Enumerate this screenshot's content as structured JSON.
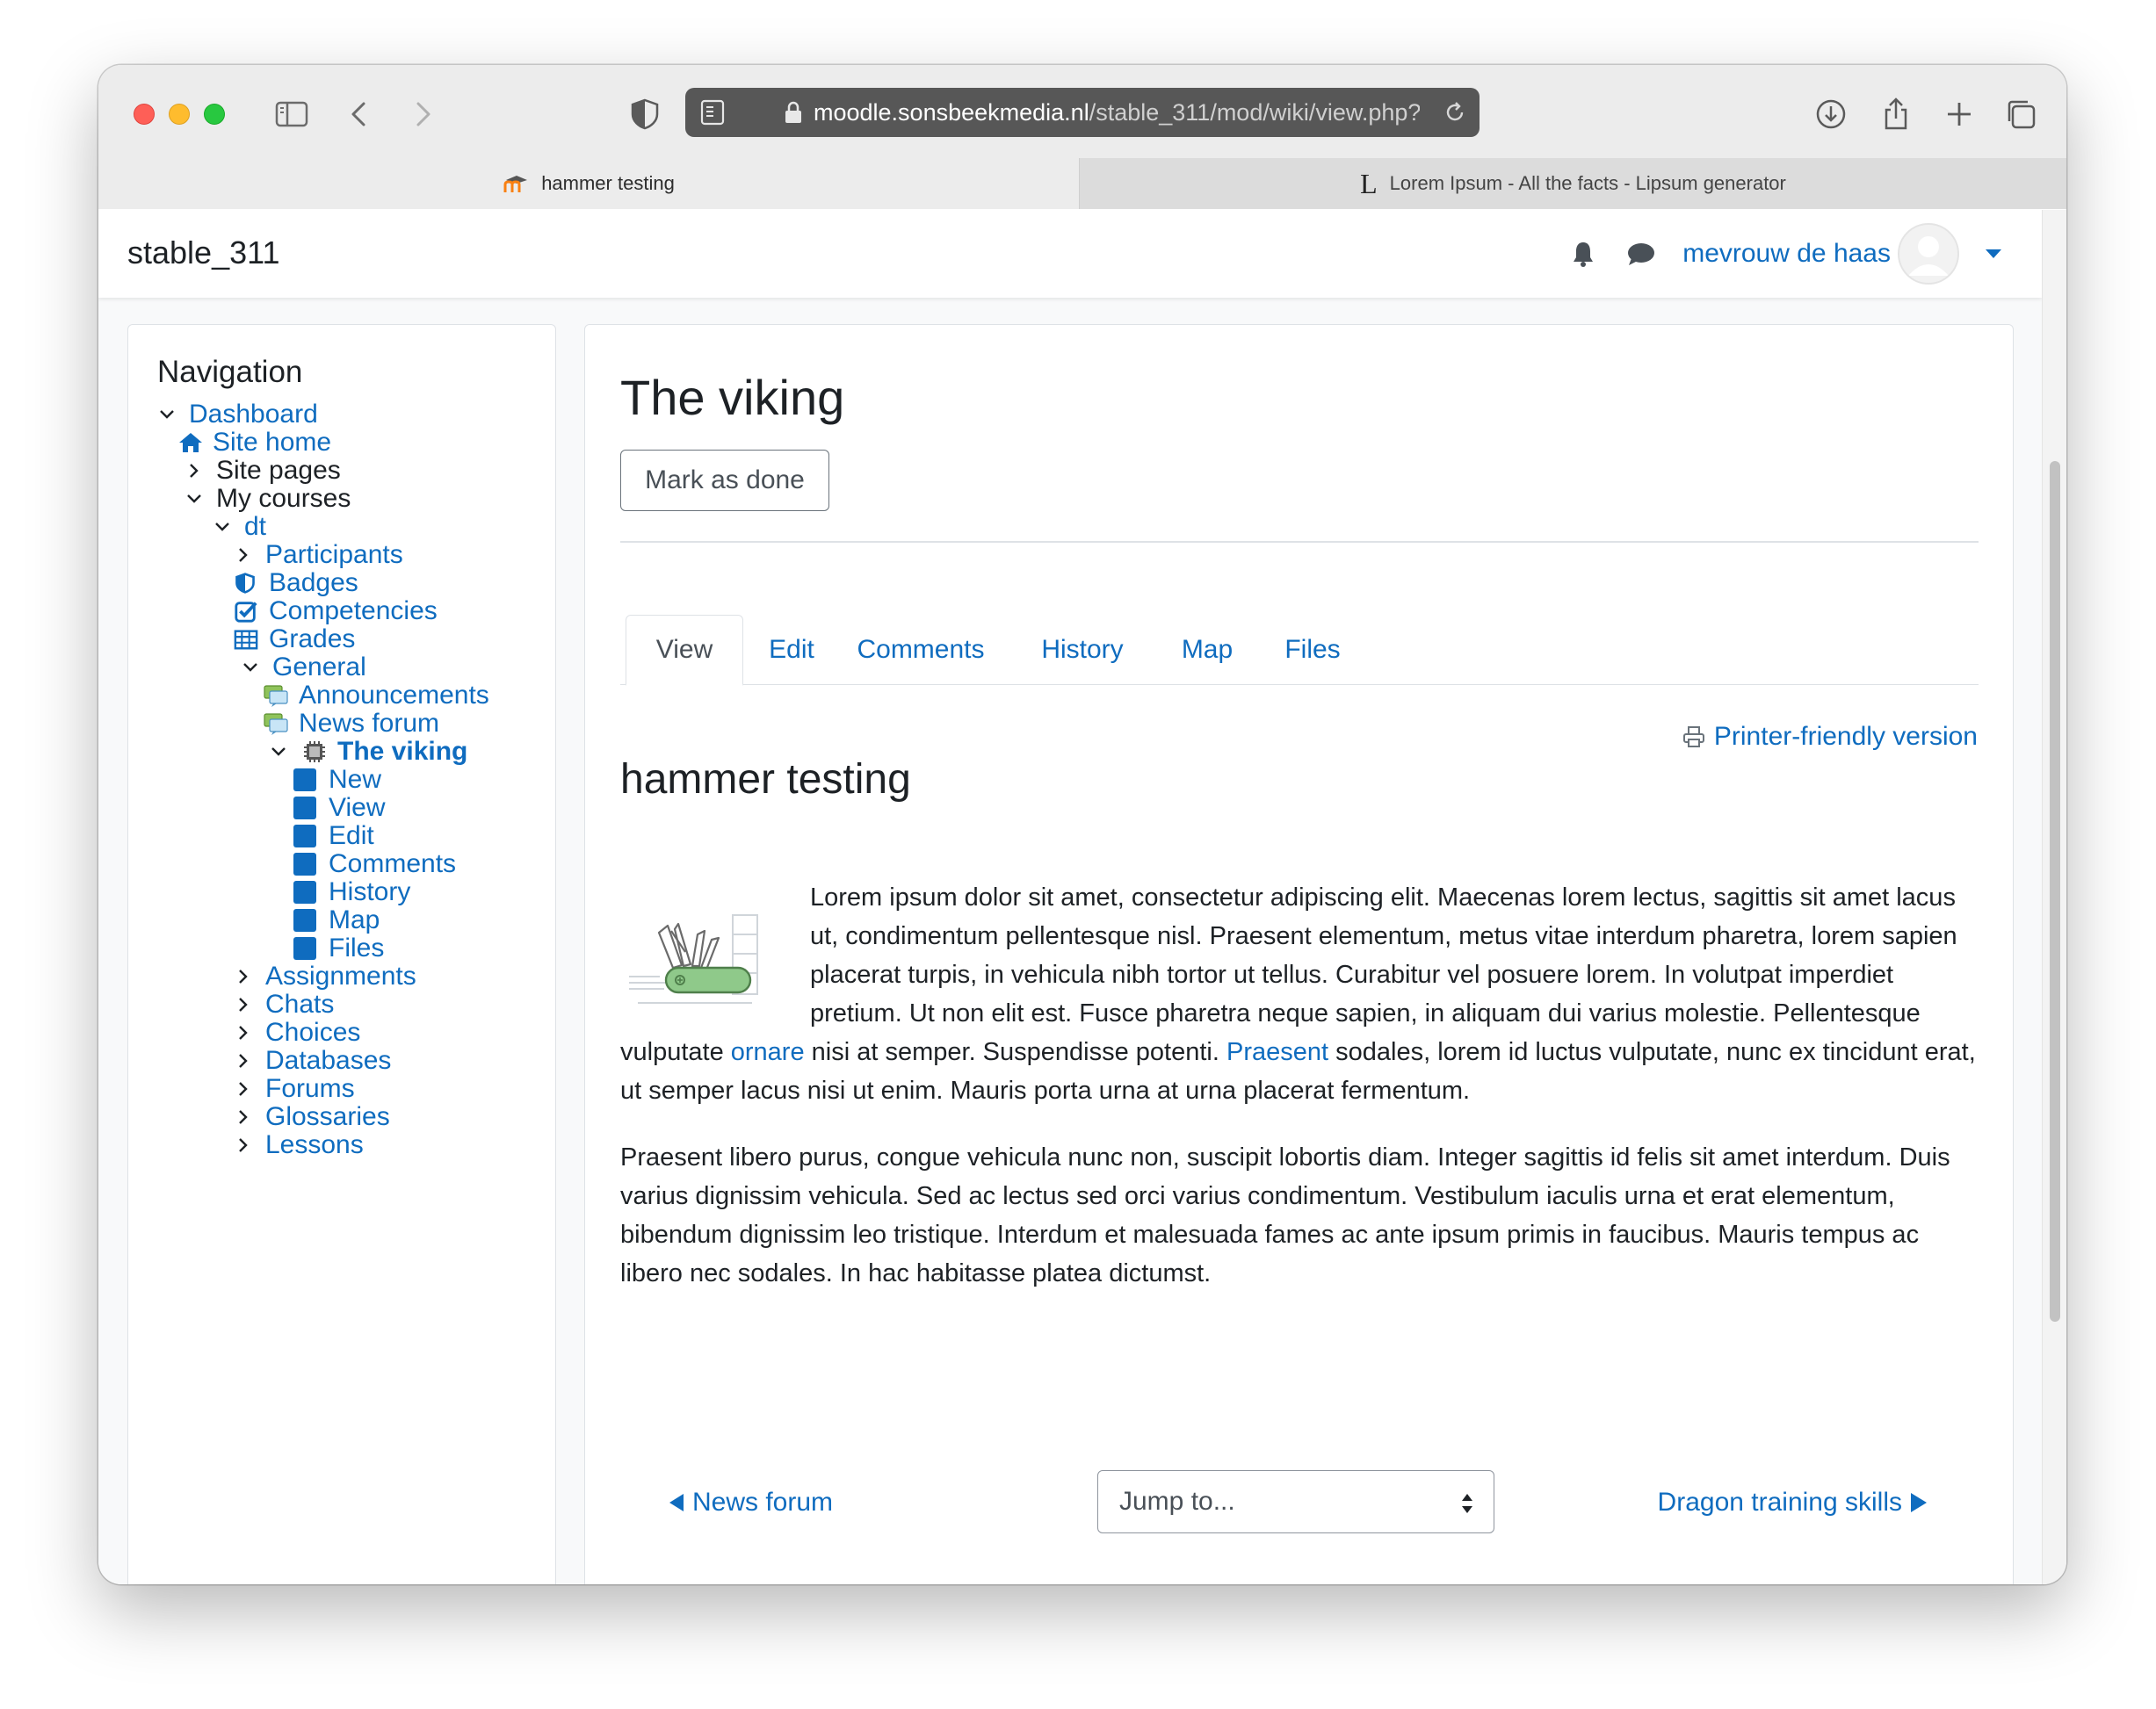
{
  "browser": {
    "url_domain": "moodle.sonsbeekmedia.nl",
    "url_path": "/stable_311/mod/wiki/view.php?",
    "tabs": [
      {
        "title": "hammer testing",
        "active": true
      },
      {
        "title": "Lorem Ipsum - All the facts - Lipsum generator",
        "active": false,
        "favicon_letter": "L"
      }
    ]
  },
  "header": {
    "brand": "stable_311",
    "user_name": "mevrouw de haas"
  },
  "navigation": {
    "title": "Navigation",
    "items": [
      {
        "label": "Dashboard"
      },
      {
        "label": "Site home"
      },
      {
        "label": "Site pages"
      },
      {
        "label": "My courses"
      },
      {
        "label": "dt"
      },
      {
        "label": "Participants"
      },
      {
        "label": "Badges"
      },
      {
        "label": "Competencies"
      },
      {
        "label": "Grades"
      },
      {
        "label": "General"
      },
      {
        "label": "Announcements"
      },
      {
        "label": "News forum"
      },
      {
        "label": "The viking"
      },
      {
        "label": "New"
      },
      {
        "label": "View"
      },
      {
        "label": "Edit"
      },
      {
        "label": "Comments"
      },
      {
        "label": "History"
      },
      {
        "label": "Map"
      },
      {
        "label": "Files"
      },
      {
        "label": "Assignments"
      },
      {
        "label": "Chats"
      },
      {
        "label": "Choices"
      },
      {
        "label": "Databases"
      },
      {
        "label": "Forums"
      },
      {
        "label": "Glossaries"
      },
      {
        "label": "Lessons"
      }
    ]
  },
  "main": {
    "title": "The viking",
    "mark_done_label": "Mark as done",
    "tabs": [
      {
        "label": "View",
        "active": true
      },
      {
        "label": "Edit"
      },
      {
        "label": "Comments"
      },
      {
        "label": "History"
      },
      {
        "label": "Map"
      },
      {
        "label": "Files"
      }
    ],
    "printer_label": "Printer-friendly version",
    "page_title": "hammer testing",
    "paragraph1": {
      "part1": "Lorem ipsum dolor sit amet, consectetur adipiscing elit. Maecenas lorem lectus, sagittis sit amet lacus ut, condimentum pellentesque nisl. Praesent elementum, metus vitae interdum pharetra, lorem sapien placerat turpis, in vehicula nibh tortor ut tellus. Curabitur vel posuere lorem. In volutpat imperdiet pretium. Ut non elit est. Fusce pharetra neque sapien, in aliquam dui varius molestie. Pellentesque vulputate ",
      "link1": "ornare",
      "part2": " nisi at semper. Suspendisse potenti. ",
      "link2": "Praesent",
      "part3": " sodales, lorem id luctus vulputate, nunc ex tincidunt erat, ut semper lacus nisi ut enim. Mauris porta urna at urna placerat fermentum."
    },
    "paragraph2": "Praesent libero purus, congue vehicula nunc non, suscipit lobortis diam. Integer sagittis id felis sit amet interdum. Duis varius dignissim vehicula. Sed ac lectus sed orci varius condimentum. Vestibulum iaculis urna et erat elementum, bibendum dignissim leo tristique. Interdum et malesuada fames ac ante ipsum primis in faucibus. Mauris tempus ac libero nec sodales. In hac habitasse platea dictumst.",
    "prev_activity": "News forum",
    "jump_to": "Jump to...",
    "next_activity": "Dragon training skills"
  },
  "colors": {
    "link": "#0f6cbf",
    "text": "#1d2125"
  }
}
